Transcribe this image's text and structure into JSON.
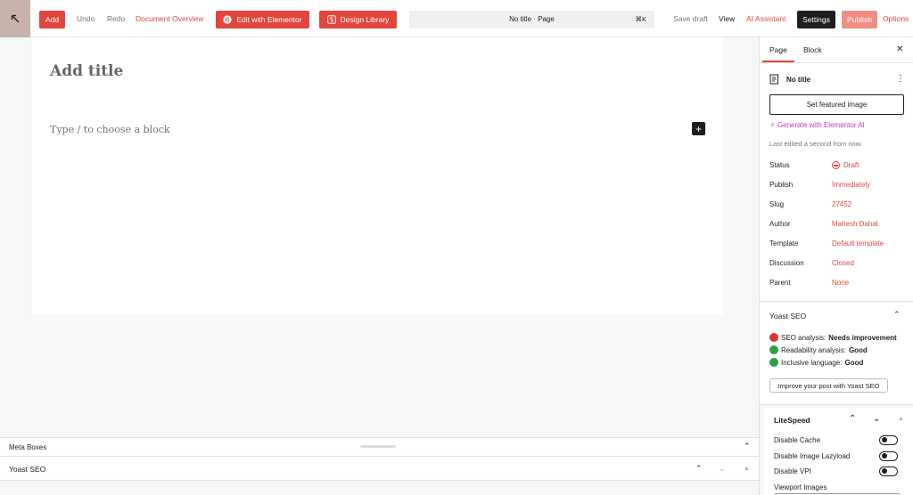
{
  "toolbar": {
    "add_label": "Add",
    "undo_label": "Undo",
    "redo_label": "Redo",
    "document_overview_label": "Document Overview",
    "edit_elementor_label": "Edit with Elementor",
    "design_library_label": "Design Library",
    "command_title": "No title · Page",
    "command_shortcut": "⌘K",
    "save_draft_label": "Save draft",
    "view_label": "View",
    "ai_assistant_label": "AI Assistant",
    "settings_label": "Settings",
    "publish_label": "Publish",
    "options_label": "Options"
  },
  "editor": {
    "title_placeholder": "Add title",
    "block_placeholder": "Type / to choose a block"
  },
  "bottom": {
    "meta_boxes_label": "Meta Boxes",
    "yoast_label": "Yoast SEO"
  },
  "sidebar": {
    "tabs": [
      {
        "label": "Page"
      },
      {
        "label": "Block"
      }
    ],
    "doc_title": "No title",
    "featured_image_label": "Set featured image",
    "ai_generate_label": "Generate with Elementor AI",
    "last_edited": "Last edited a second from now.",
    "properties": [
      {
        "key": "Status",
        "value": "Draft"
      },
      {
        "key": "Publish",
        "value": "Immediately"
      },
      {
        "key": "Slug",
        "value": "27452"
      },
      {
        "key": "Author",
        "value": "Mahesh Dahal"
      },
      {
        "key": "Template",
        "value": "Default template"
      },
      {
        "key": "Discussion",
        "value": "Closed"
      },
      {
        "key": "Parent",
        "value": "None"
      }
    ],
    "yoast": {
      "title": "Yoast SEO",
      "seo_prefix": "SEO analysis: ",
      "seo_value": "Needs improvement",
      "readability_prefix": "Readability analysis: ",
      "readability_value": "Good",
      "inclusive_prefix": "Inclusive language: ",
      "inclusive_value": "Good",
      "improve_label": "Improve your post with Yoast SEO"
    },
    "litespeed": {
      "title": "LiteSpeed",
      "disable_cache": "Disable Cache",
      "disable_lazyload": "Disable Image Lazyload",
      "disable_vpi": "Disable VPI",
      "viewport_images": "Viewport Images"
    }
  },
  "colors": {
    "accent": "#e2463c",
    "ai_purple": "#c036c8",
    "good": "#2e9f45",
    "bad": "#dc3232"
  }
}
